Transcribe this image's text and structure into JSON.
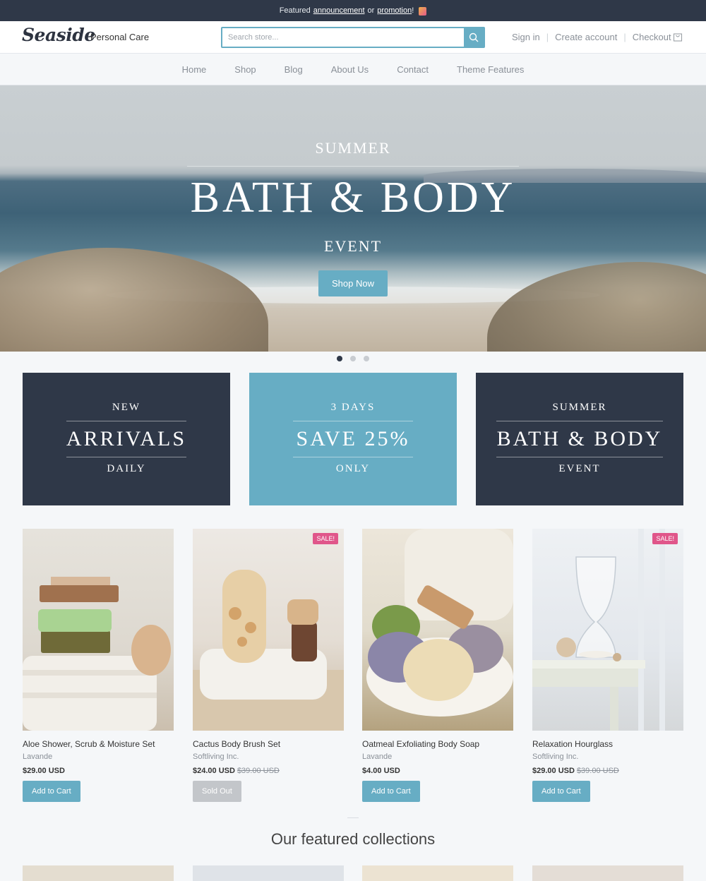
{
  "announcement": {
    "prefix": "Featured",
    "link1": "announcement",
    "middle": "or",
    "link2": "promotion",
    "suffix": "!"
  },
  "header": {
    "logo": "Seaside",
    "tagline": "Personal Care",
    "search_placeholder": "Search store...",
    "sign_in": "Sign in",
    "create_account": "Create account",
    "checkout": "Checkout"
  },
  "nav": {
    "items": [
      "Home",
      "Shop",
      "Blog",
      "About Us",
      "Contact",
      "Theme Features"
    ]
  },
  "hero": {
    "kicker": "SUMMER",
    "title": "BATH & BODY",
    "subtitle": "EVENT",
    "button": "Shop Now",
    "active_slide": 1,
    "slide_count": 3
  },
  "promos": [
    {
      "top": "NEW",
      "title": "ARRIVALS",
      "bottom": "DAILY"
    },
    {
      "top": "3 DAYS",
      "title": "SAVE 25%",
      "bottom": "ONLY"
    },
    {
      "top": "SUMMER",
      "title": "BATH & BODY",
      "bottom": "EVENT"
    }
  ],
  "products": [
    {
      "name": "Aloe Shower, Scrub & Moisture Set",
      "vendor": "Lavande",
      "price": "$29.00 USD",
      "compare": "",
      "button": "Add to Cart",
      "sale": ""
    },
    {
      "name": "Cactus Body Brush Set",
      "vendor": "Softliving Inc.",
      "price": "$24.00 USD",
      "compare": "$39.00 USD",
      "button": "Sold Out",
      "sale": "SALE!"
    },
    {
      "name": "Oatmeal Exfoliating Body Soap",
      "vendor": "Lavande",
      "price": "$4.00 USD",
      "compare": "",
      "button": "Add to Cart",
      "sale": ""
    },
    {
      "name": "Relaxation Hourglass",
      "vendor": "Softliving Inc.",
      "price": "$29.00 USD",
      "compare": "$39.00 USD",
      "button": "Add to Cart",
      "sale": "SALE!"
    }
  ],
  "featured": {
    "title": "Our featured collections"
  },
  "colors": {
    "accent": "#67adc4",
    "dark": "#2f3848",
    "sale": "#e0568a"
  }
}
